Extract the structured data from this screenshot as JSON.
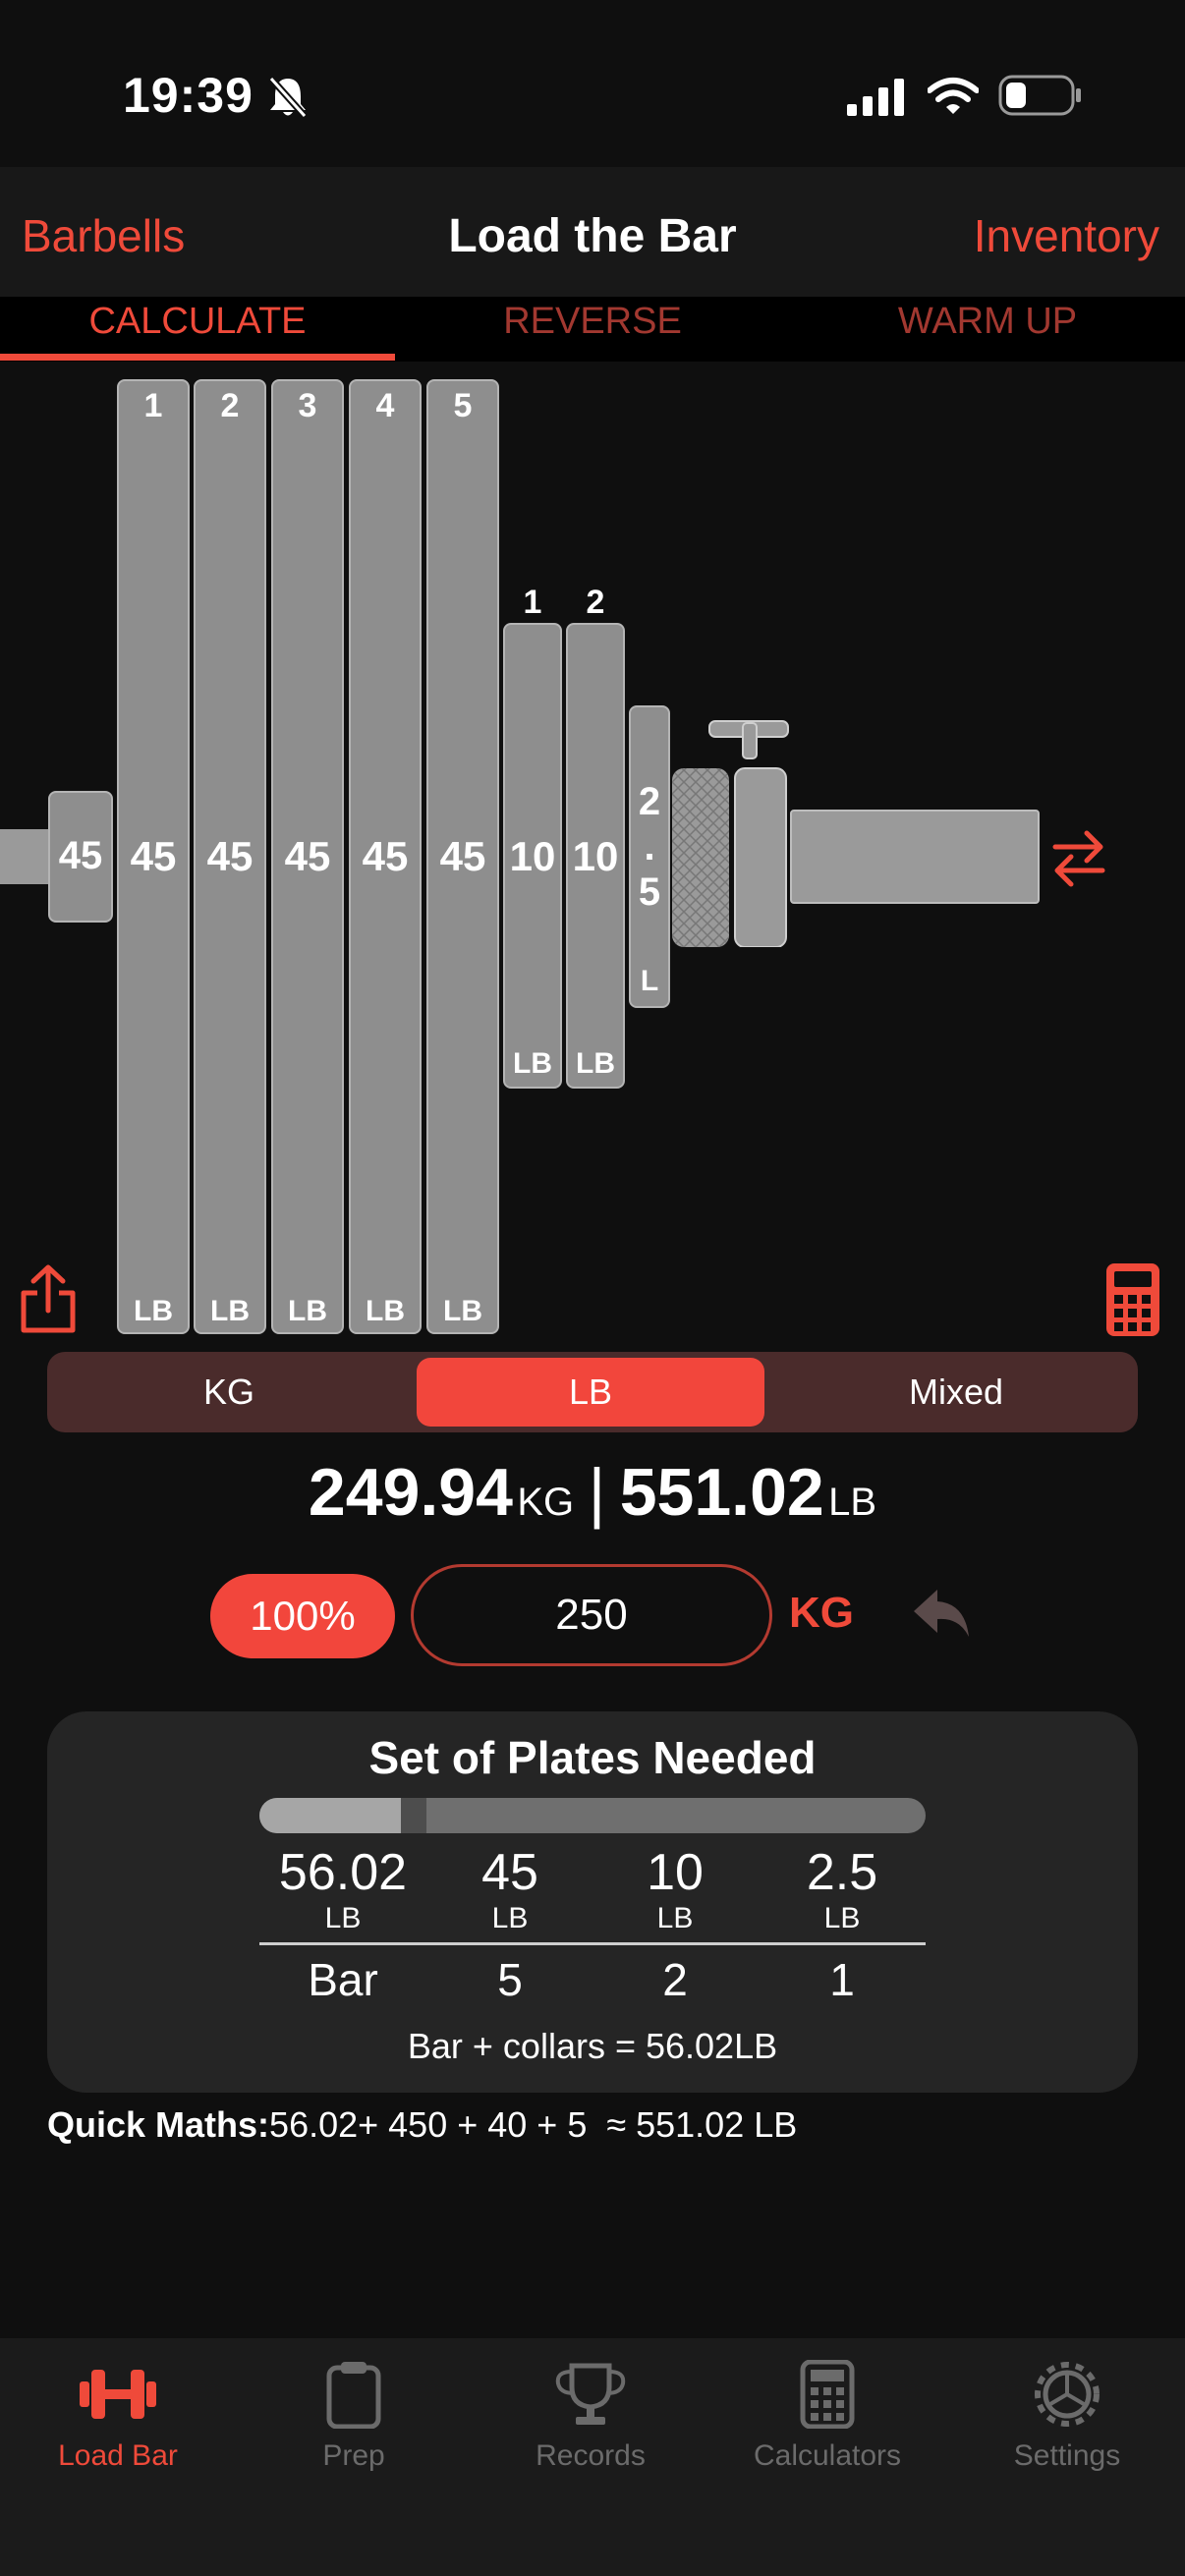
{
  "status_bar": {
    "time": "19:39"
  },
  "nav": {
    "left": "Barbells",
    "title": "Load the Bar",
    "right": "Inventory"
  },
  "tabs": [
    "CALCULATE",
    "REVERSE",
    "WARM UP"
  ],
  "collar_plate": {
    "weight": "45"
  },
  "plates": [
    {
      "index": "1",
      "weight": "45",
      "unit": "LB"
    },
    {
      "index": "2",
      "weight": "45",
      "unit": "LB"
    },
    {
      "index": "3",
      "weight": "45",
      "unit": "LB"
    },
    {
      "index": "4",
      "weight": "45",
      "unit": "LB"
    },
    {
      "index": "5",
      "weight": "45",
      "unit": "LB"
    },
    {
      "index": "1",
      "weight": "10",
      "unit": "LB"
    },
    {
      "index": "2",
      "weight": "10",
      "unit": "LB"
    }
  ],
  "small_plate": {
    "chars": [
      "2",
      ".",
      "5"
    ],
    "unit": "L"
  },
  "unit_selector": {
    "options": [
      "KG",
      "LB",
      "Mixed"
    ],
    "selected": "LB"
  },
  "totals": {
    "kg": "249.94",
    "kg_unit": "KG",
    "sep": "|",
    "lb": "551.02",
    "lb_unit": "LB"
  },
  "input": {
    "percent": "100%",
    "value": "250",
    "unit": "KG"
  },
  "plates_needed": {
    "title": "Set of Plates Needed",
    "columns": [
      {
        "weight": "56.02",
        "unit": "LB",
        "count": "Bar"
      },
      {
        "weight": "45",
        "unit": "LB",
        "count": "5"
      },
      {
        "weight": "10",
        "unit": "LB",
        "count": "2"
      },
      {
        "weight": "2.5",
        "unit": "LB",
        "count": "1"
      }
    ],
    "footer": "Bar + collars = 56.02LB"
  },
  "quick_maths": {
    "label": "Quick Maths:",
    "value": "56.02+ 450 + 40 + 5  ≈ 551.02 LB"
  },
  "tab_bar": [
    {
      "label": "Load Bar",
      "icon": "dumbbell-icon",
      "active": true
    },
    {
      "label": "Prep",
      "icon": "clipboard-icon",
      "active": false
    },
    {
      "label": "Records",
      "icon": "trophy-icon",
      "active": false
    },
    {
      "label": "Calculators",
      "icon": "calculator-icon",
      "active": false
    },
    {
      "label": "Settings",
      "icon": "gear-icon",
      "active": false
    }
  ],
  "colors": {
    "accent": "#ef4a3a",
    "plate": "#8e8e8e",
    "background": "#0f0f0f",
    "card": "#252525"
  }
}
